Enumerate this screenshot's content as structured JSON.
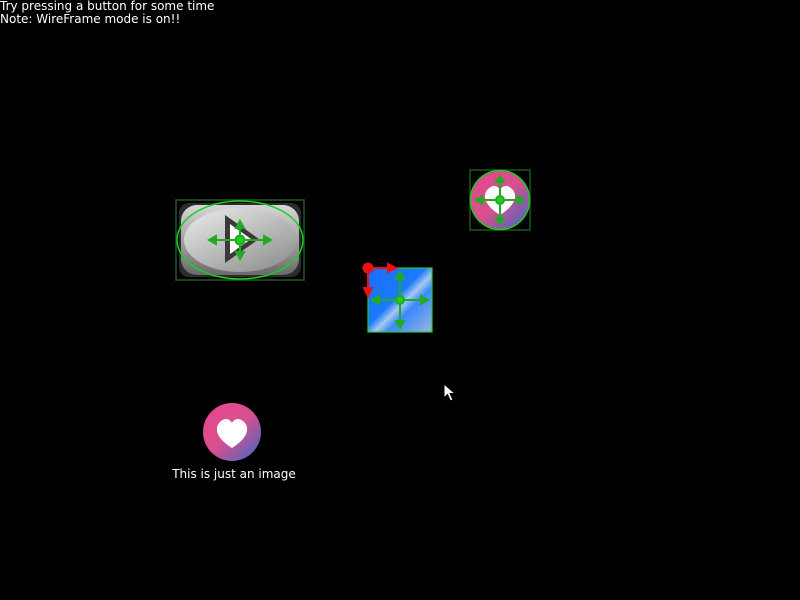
{
  "hints": {
    "line1": "Try pressing a button for some time",
    "line2": "Note: WireFrame mode is on!!"
  },
  "image_widget": {
    "caption": "This is just an image"
  },
  "icons": {
    "play": "play-icon",
    "heart": "heart-icon",
    "cursor": "mouse-pointer-icon"
  },
  "colors": {
    "background": "#000000",
    "wireframe_green": "#22cc22",
    "wireframe_dark_green": "#1a5a1a",
    "anchor_red": "#ee1111",
    "heart_pink": "#e8458c",
    "heart_blue": "#3a68c8",
    "blue_square": "#1a78ff"
  }
}
